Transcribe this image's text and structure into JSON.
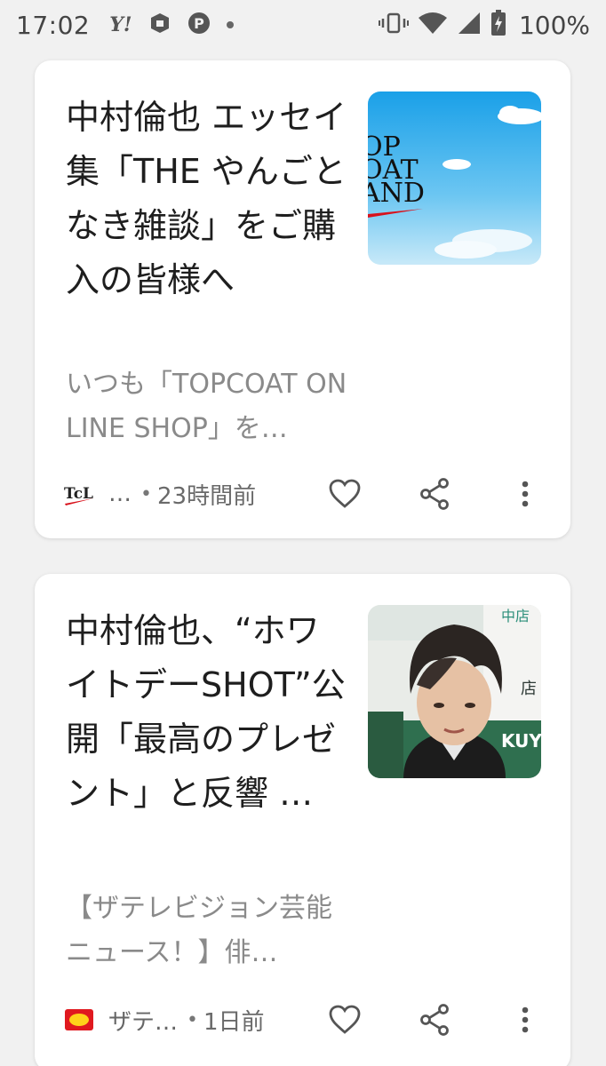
{
  "status_bar": {
    "time": "17:02",
    "battery": "100%",
    "left_icons": [
      "yahoo-icon",
      "tiktok-box-icon",
      "pinterest-icon",
      "dot-icon"
    ],
    "right_icons": [
      "vibrate-icon",
      "wifi-icon",
      "signal-icon",
      "battery-icon"
    ]
  },
  "cards": [
    {
      "headline": "中村倫也 エッセイ集「THE やんごとなき雑談」をご購入の皆様へ",
      "snippet": "いつも「TOPCOAT ONLINE SHOP」を…",
      "source_name": "…",
      "time": "23時間前",
      "thumb_text": "OP COAT AND",
      "source_logo": "TcL"
    },
    {
      "headline": "中村倫也、“ホワイトデーSHOT”公開「最高のプレゼント」と反響 …",
      "snippet": "【ザテレビジョン芸能ニュース！】俳…",
      "source_name": "ザテ…",
      "time": "1日前"
    }
  ],
  "colors": {
    "background": "#f1f1f1",
    "card": "#ffffff",
    "headline": "#1e1e1e",
    "snippet": "#8a8a8a",
    "meta": "#6a6a6a"
  }
}
